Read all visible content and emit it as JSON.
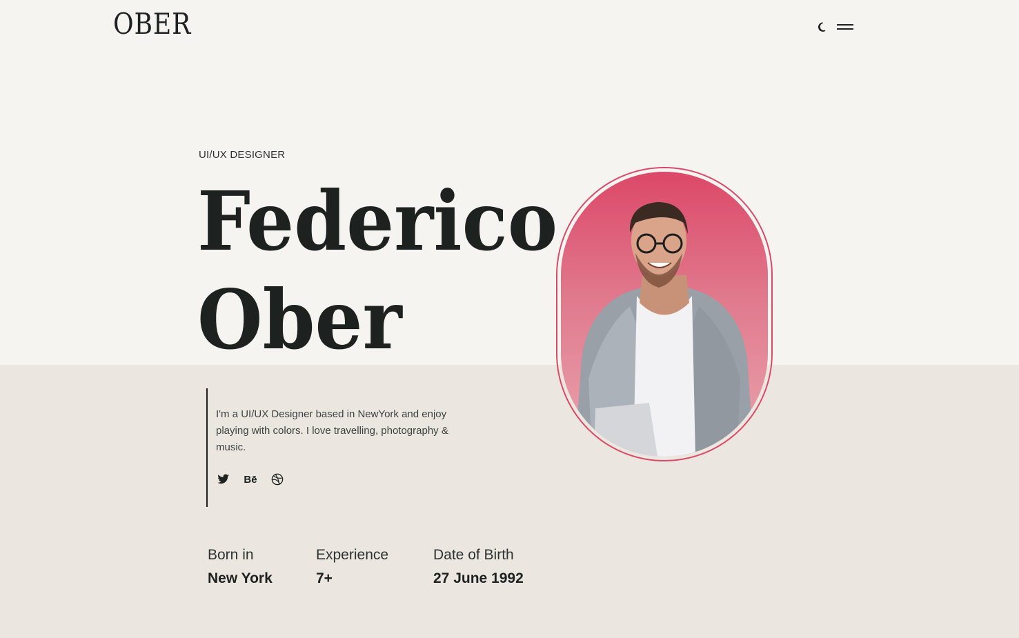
{
  "header": {
    "logo": "OBER",
    "theme_toggle_icon": "moon-icon",
    "menu_icon": "hamburger-menu-icon"
  },
  "hero": {
    "role": "UI/UX DESIGNER",
    "first_name": "Federico",
    "last_name": "Ober",
    "bio": "I'm a UI/UX Designer based in NewYork and enjoy playing with colors. I love travelling, photography & music.",
    "social": [
      {
        "icon": "twitter-icon"
      },
      {
        "icon": "behance-icon",
        "label": "Bē"
      },
      {
        "icon": "dribbble-icon"
      }
    ]
  },
  "facts": [
    {
      "label": "Born in",
      "value": "New York"
    },
    {
      "label": "Experience",
      "value": "7+"
    },
    {
      "label": "Date of Birth",
      "value": "27 June 1992"
    }
  ],
  "colors": {
    "accent": "#d94a66",
    "background_top": "#f6f4f1",
    "background_bottom": "#ebe6e0",
    "text": "#1d2221"
  }
}
